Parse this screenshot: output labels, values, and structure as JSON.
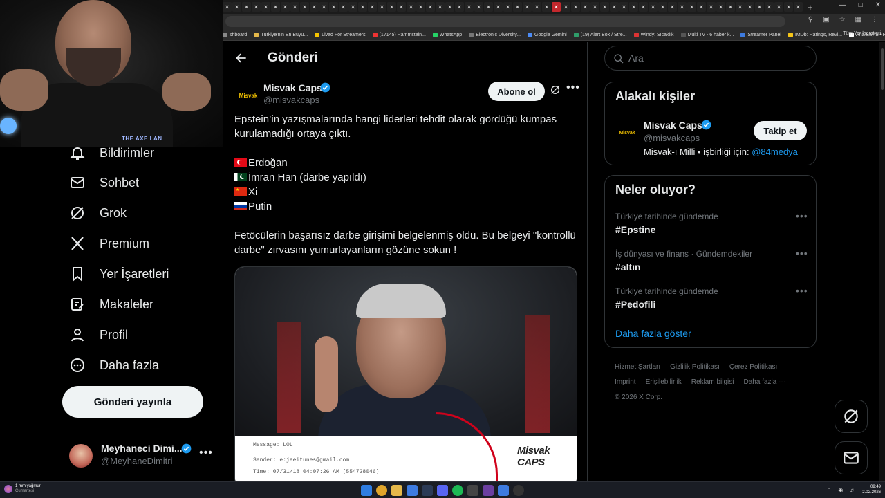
{
  "browser": {
    "bookmarks": [
      "shboard",
      "Türkiye'nin En Büyü...",
      "Livad For Streamers",
      "(17145) Rammstein...",
      "WhatsApp",
      "Electronic Diversity...",
      "Google Gemini",
      "(19) Alert Box / Stre...",
      "Windy: Sıcaklık",
      "Multi TV - 6 haber k...",
      "Streamer Panel",
      "IMDb: Ratings, Revi...",
      "Ana Sayfa • HBO Max"
    ],
    "bookmarks_more": "»",
    "all_bookmarks": "Tüm Yer İşaretleri",
    "new_tab": "+"
  },
  "webcam": {
    "overlay_logo": "THE AXE LAN"
  },
  "nav": {
    "items": [
      {
        "label": "Bildirimler",
        "icon": "bell-icon"
      },
      {
        "label": "Sohbet",
        "icon": "mail-icon"
      },
      {
        "label": "Grok",
        "icon": "grok-icon"
      },
      {
        "label": "Premium",
        "icon": "x-logo-icon"
      },
      {
        "label": "Yer İşaretleri",
        "icon": "bookmark-icon"
      },
      {
        "label": "Makaleler",
        "icon": "article-icon"
      },
      {
        "label": "Profil",
        "icon": "person-icon"
      },
      {
        "label": "Daha fazla",
        "icon": "more-circle-icon"
      }
    ],
    "post_button": "Gönderi yayınla",
    "account": {
      "name": "Meyhaneci Dimi...",
      "handle": "@MeyhaneDimitri",
      "more": "•••"
    }
  },
  "post": {
    "header_title": "Gönderi",
    "author_name": "Misvak Caps",
    "author_handle": "@misvakcaps",
    "avatar_text": "Misvak",
    "subscribe_label": "Abone ol",
    "more": "•••",
    "text_line1": "Epstein’in yazışmalarında hangi liderleri tehdit olarak gördüğü kumpas kurulamadığı ortaya çıktı.",
    "leaders": [
      {
        "flag": "tr-flag-icon",
        "name": "Erdoğan"
      },
      {
        "flag": "pk-flag-icon",
        "name": "İmran Han (darbe yapıldı)"
      },
      {
        "flag": "cn-flag-icon",
        "name": "Xi"
      },
      {
        "flag": "ru-flag-icon",
        "name": "Putin"
      }
    ],
    "text_line2": "Fetöcülerin başarısız darbe girişimi belgelenmiş oldu. Bu belgeyi \"kontrollü darbe\" zırvasını yumurlayanların gözüne sokun !",
    "media": {
      "email_message": "Message: LOL",
      "email_sender": "Sender: e:jeeitunes@gmail.com",
      "email_time": "Time: 07/31/18 04:07:26 AM (554728046)",
      "watermark": "Misvak CAPS"
    }
  },
  "right": {
    "search_placeholder": "Ara",
    "related": {
      "title": "Alakalı kişiler",
      "name": "Misvak Caps",
      "handle": "@misvakcaps",
      "avatar_text": "Misvak",
      "bio_text": "Misvak-ı Milli • işbirliği için: ",
      "bio_link": "@84medya",
      "follow_label": "Takip et"
    },
    "trends": {
      "title": "Neler oluyor?",
      "items": [
        {
          "meta": "Türkiye tarihinde gündemde",
          "name": "#Epstine"
        },
        {
          "meta": "İş dünyası ve finans · Gündemdekiler",
          "name": "#altın"
        },
        {
          "meta": "Türkiye tarihinde gündemde",
          "name": "#Pedofili"
        }
      ],
      "more_icon": "•••",
      "show_more": "Daha fazla göster"
    },
    "footer": {
      "links": [
        "Hizmet Şartları",
        "Gizlilik Politikası",
        "Çerez Politikası",
        "Imprint",
        "Erişilebilirlik",
        "Reklam bilgisi",
        "Daha fazla ···"
      ],
      "copyright": "© 2026 X Corp."
    }
  },
  "taskbar": {
    "weather_line1": "1 mm yağmur",
    "weather_line2": "Cumartesi",
    "time": "09:49",
    "date": "2.02.2026"
  },
  "colors": {
    "accent": "#1d9bf0",
    "background": "#000000",
    "border": "#2f3336",
    "muted_text": "#71767b"
  }
}
